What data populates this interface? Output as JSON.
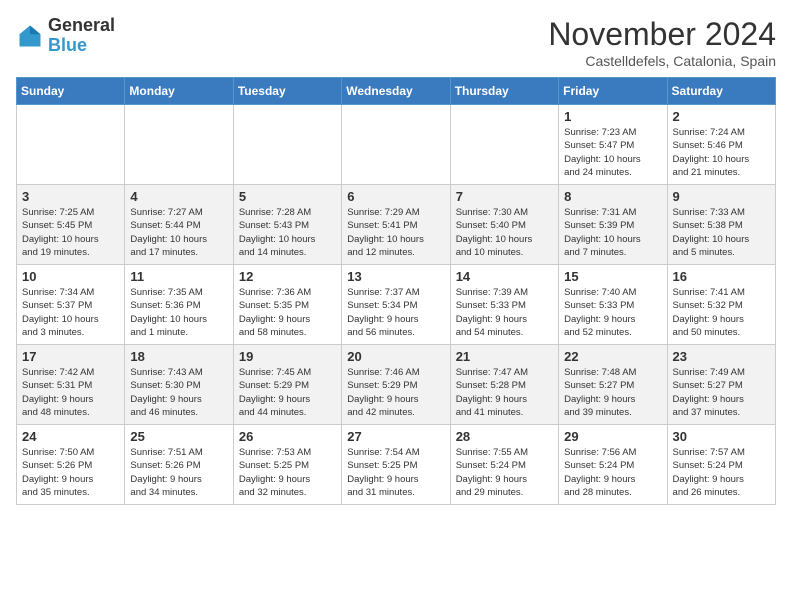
{
  "logo": {
    "general": "General",
    "blue": "Blue"
  },
  "header": {
    "month_year": "November 2024",
    "location": "Castelldefels, Catalonia, Spain"
  },
  "days_of_week": [
    "Sunday",
    "Monday",
    "Tuesday",
    "Wednesday",
    "Thursday",
    "Friday",
    "Saturday"
  ],
  "weeks": [
    [
      {
        "day": "",
        "info": ""
      },
      {
        "day": "",
        "info": ""
      },
      {
        "day": "",
        "info": ""
      },
      {
        "day": "",
        "info": ""
      },
      {
        "day": "",
        "info": ""
      },
      {
        "day": "1",
        "info": "Sunrise: 7:23 AM\nSunset: 5:47 PM\nDaylight: 10 hours\nand 24 minutes."
      },
      {
        "day": "2",
        "info": "Sunrise: 7:24 AM\nSunset: 5:46 PM\nDaylight: 10 hours\nand 21 minutes."
      }
    ],
    [
      {
        "day": "3",
        "info": "Sunrise: 7:25 AM\nSunset: 5:45 PM\nDaylight: 10 hours\nand 19 minutes."
      },
      {
        "day": "4",
        "info": "Sunrise: 7:27 AM\nSunset: 5:44 PM\nDaylight: 10 hours\nand 17 minutes."
      },
      {
        "day": "5",
        "info": "Sunrise: 7:28 AM\nSunset: 5:43 PM\nDaylight: 10 hours\nand 14 minutes."
      },
      {
        "day": "6",
        "info": "Sunrise: 7:29 AM\nSunset: 5:41 PM\nDaylight: 10 hours\nand 12 minutes."
      },
      {
        "day": "7",
        "info": "Sunrise: 7:30 AM\nSunset: 5:40 PM\nDaylight: 10 hours\nand 10 minutes."
      },
      {
        "day": "8",
        "info": "Sunrise: 7:31 AM\nSunset: 5:39 PM\nDaylight: 10 hours\nand 7 minutes."
      },
      {
        "day": "9",
        "info": "Sunrise: 7:33 AM\nSunset: 5:38 PM\nDaylight: 10 hours\nand 5 minutes."
      }
    ],
    [
      {
        "day": "10",
        "info": "Sunrise: 7:34 AM\nSunset: 5:37 PM\nDaylight: 10 hours\nand 3 minutes."
      },
      {
        "day": "11",
        "info": "Sunrise: 7:35 AM\nSunset: 5:36 PM\nDaylight: 10 hours\nand 1 minute."
      },
      {
        "day": "12",
        "info": "Sunrise: 7:36 AM\nSunset: 5:35 PM\nDaylight: 9 hours\nand 58 minutes."
      },
      {
        "day": "13",
        "info": "Sunrise: 7:37 AM\nSunset: 5:34 PM\nDaylight: 9 hours\nand 56 minutes."
      },
      {
        "day": "14",
        "info": "Sunrise: 7:39 AM\nSunset: 5:33 PM\nDaylight: 9 hours\nand 54 minutes."
      },
      {
        "day": "15",
        "info": "Sunrise: 7:40 AM\nSunset: 5:33 PM\nDaylight: 9 hours\nand 52 minutes."
      },
      {
        "day": "16",
        "info": "Sunrise: 7:41 AM\nSunset: 5:32 PM\nDaylight: 9 hours\nand 50 minutes."
      }
    ],
    [
      {
        "day": "17",
        "info": "Sunrise: 7:42 AM\nSunset: 5:31 PM\nDaylight: 9 hours\nand 48 minutes."
      },
      {
        "day": "18",
        "info": "Sunrise: 7:43 AM\nSunset: 5:30 PM\nDaylight: 9 hours\nand 46 minutes."
      },
      {
        "day": "19",
        "info": "Sunrise: 7:45 AM\nSunset: 5:29 PM\nDaylight: 9 hours\nand 44 minutes."
      },
      {
        "day": "20",
        "info": "Sunrise: 7:46 AM\nSunset: 5:29 PM\nDaylight: 9 hours\nand 42 minutes."
      },
      {
        "day": "21",
        "info": "Sunrise: 7:47 AM\nSunset: 5:28 PM\nDaylight: 9 hours\nand 41 minutes."
      },
      {
        "day": "22",
        "info": "Sunrise: 7:48 AM\nSunset: 5:27 PM\nDaylight: 9 hours\nand 39 minutes."
      },
      {
        "day": "23",
        "info": "Sunrise: 7:49 AM\nSunset: 5:27 PM\nDaylight: 9 hours\nand 37 minutes."
      }
    ],
    [
      {
        "day": "24",
        "info": "Sunrise: 7:50 AM\nSunset: 5:26 PM\nDaylight: 9 hours\nand 35 minutes."
      },
      {
        "day": "25",
        "info": "Sunrise: 7:51 AM\nSunset: 5:26 PM\nDaylight: 9 hours\nand 34 minutes."
      },
      {
        "day": "26",
        "info": "Sunrise: 7:53 AM\nSunset: 5:25 PM\nDaylight: 9 hours\nand 32 minutes."
      },
      {
        "day": "27",
        "info": "Sunrise: 7:54 AM\nSunset: 5:25 PM\nDaylight: 9 hours\nand 31 minutes."
      },
      {
        "day": "28",
        "info": "Sunrise: 7:55 AM\nSunset: 5:24 PM\nDaylight: 9 hours\nand 29 minutes."
      },
      {
        "day": "29",
        "info": "Sunrise: 7:56 AM\nSunset: 5:24 PM\nDaylight: 9 hours\nand 28 minutes."
      },
      {
        "day": "30",
        "info": "Sunrise: 7:57 AM\nSunset: 5:24 PM\nDaylight: 9 hours\nand 26 minutes."
      }
    ]
  ]
}
